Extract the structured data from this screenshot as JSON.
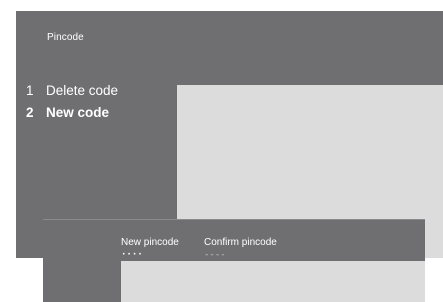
{
  "screen": {
    "title": "Pincode"
  },
  "menu": {
    "items": [
      {
        "number": "1",
        "label": "Delete code",
        "selected": false
      },
      {
        "number": "2",
        "label": "New code",
        "selected": true
      }
    ]
  },
  "dialog": {
    "new_pincode": {
      "label": "New pincode",
      "value": "····"
    },
    "confirm_pincode": {
      "label": "Confirm pincode",
      "value": "----"
    }
  },
  "colors": {
    "panel": "#6f6f72",
    "content": "#dcdcdd",
    "text": "#ffffff"
  }
}
